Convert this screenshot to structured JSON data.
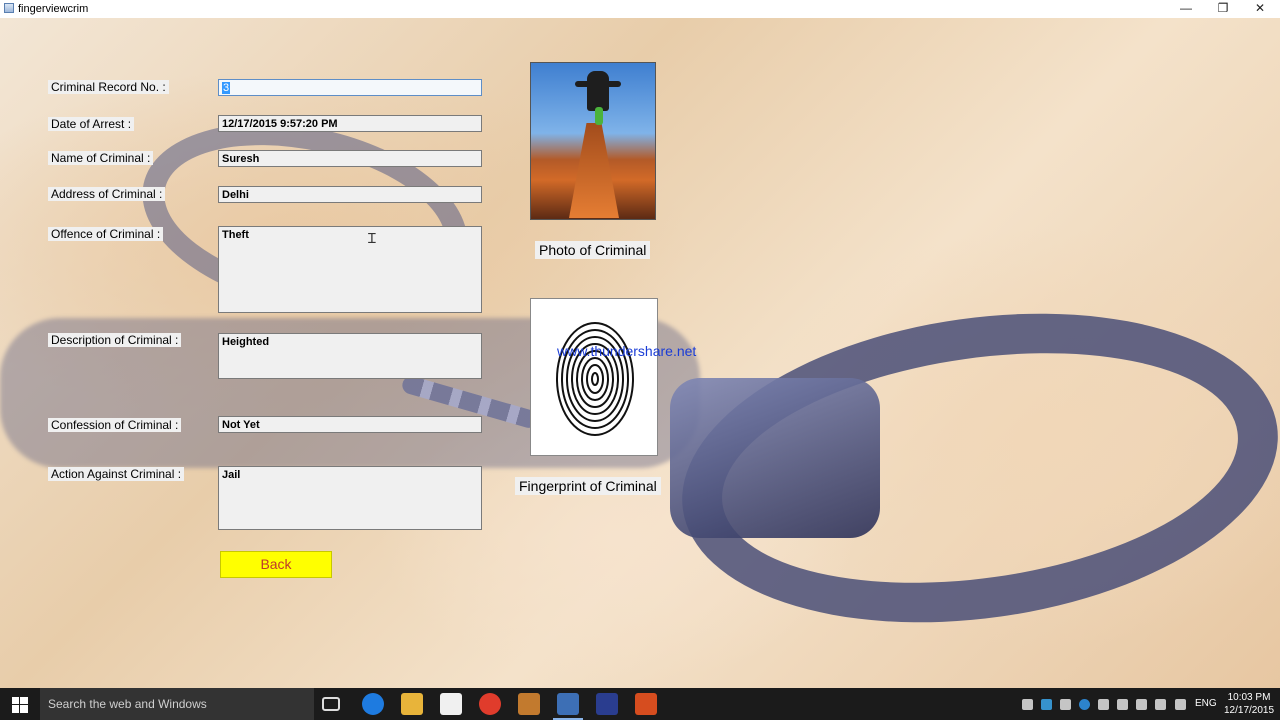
{
  "window": {
    "title": "fingerviewcrim",
    "minimize_glyph": "—",
    "maximize_glyph": "❐",
    "close_glyph": "✕"
  },
  "form": {
    "record_no": {
      "label": "Criminal Record No. :",
      "value": "3"
    },
    "date_of_arrest": {
      "label": "Date of Arrest :",
      "value": "12/17/2015 9:57:20 PM"
    },
    "name": {
      "label": "Name of Criminal :",
      "value": "Suresh"
    },
    "address": {
      "label": "Address of Criminal :",
      "value": "Delhi"
    },
    "offence": {
      "label": "Offence of Criminal :",
      "value": "Theft"
    },
    "description": {
      "label": "Description of Criminal :",
      "value": "Heighted"
    },
    "confession": {
      "label": "Confession of Criminal :",
      "value": "Not Yet"
    },
    "action": {
      "label": "Action Against Criminal :",
      "value": "Jail"
    }
  },
  "photo_caption": "Photo of Criminal",
  "fingerprint_caption": "Fingerprint of Criminal",
  "watermark": "www.thundershare.net",
  "back_button": "Back",
  "taskbar": {
    "search_placeholder": "Search the web and Windows",
    "language": "ENG",
    "time": "10:03 PM",
    "date": "12/17/2015"
  },
  "colors": {
    "back_button_bg": "#ffff00",
    "back_button_text": "#c0392b",
    "watermark": "#1a3cd6",
    "selection": "#3399ff",
    "taskbar": "#1b1b1b"
  }
}
